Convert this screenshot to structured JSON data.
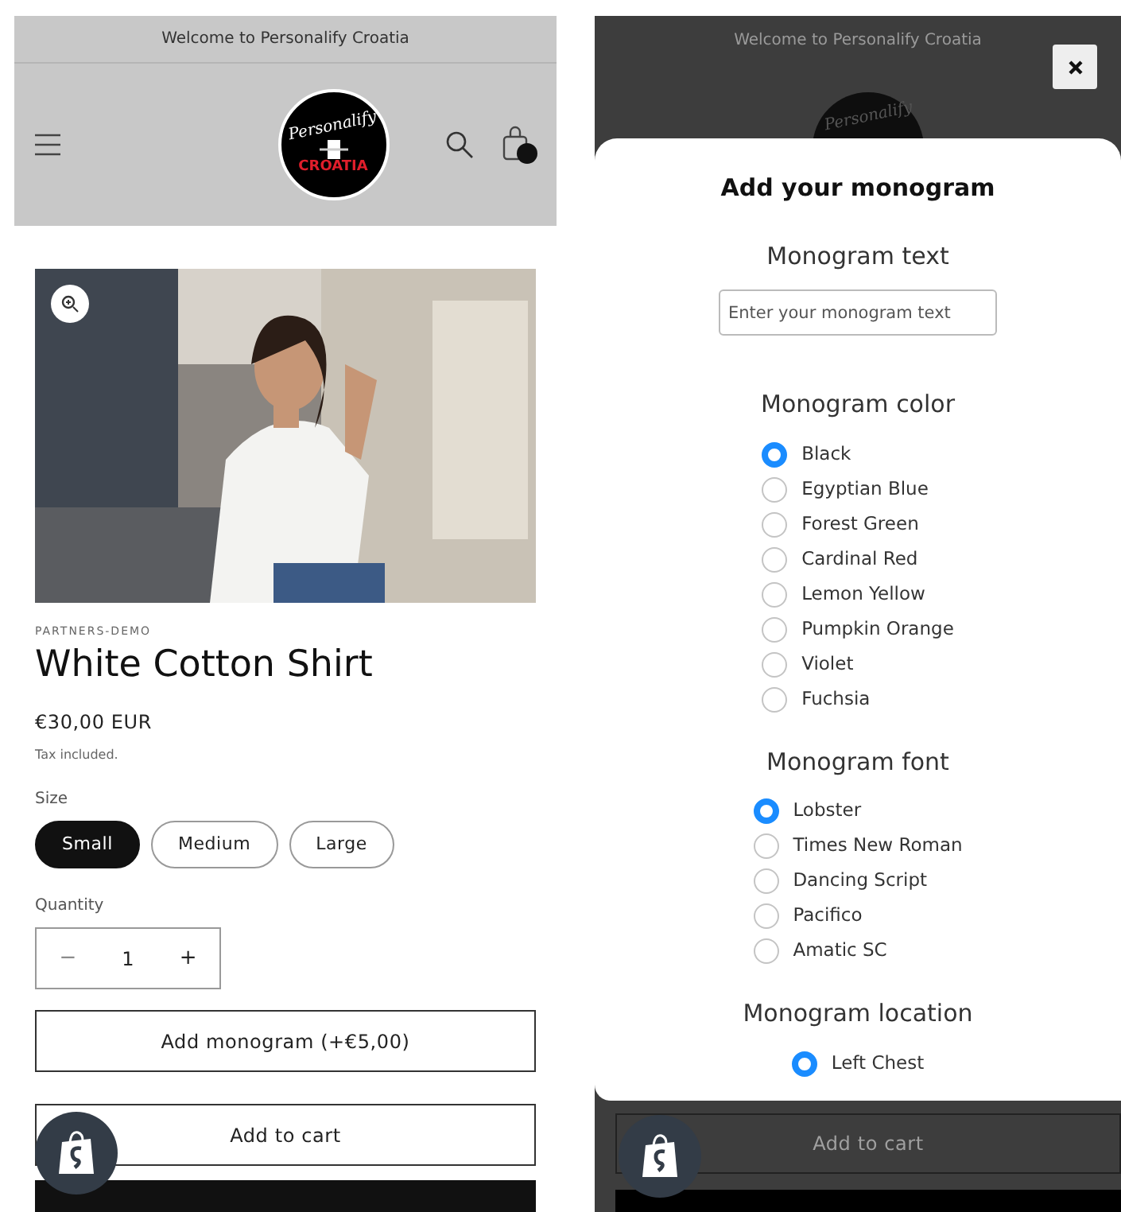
{
  "product_page": {
    "announcement": "Welcome to Personalify Croatia",
    "logo": {
      "top": "Personalify",
      "bottom": "CROATIA"
    },
    "cart_has_items": true,
    "vendor": "PARTNERS-DEMO",
    "title": "White Cotton Shirt",
    "price": "€30,00 EUR",
    "tax_note": "Tax included.",
    "size_label": "Size",
    "sizes": [
      {
        "label": "Small",
        "selected": true
      },
      {
        "label": "Medium",
        "selected": false
      },
      {
        "label": "Large",
        "selected": false
      }
    ],
    "quantity_label": "Quantity",
    "quantity": {
      "minus": "−",
      "value": "1",
      "plus": "+"
    },
    "monogram_button": "Add monogram (+€5,00)",
    "add_to_cart": "Add to cart"
  },
  "modal_view": {
    "background": {
      "announcement": "Welcome to Personalify Croatia",
      "logo_top": "Personalify",
      "add_to_cart": "Add to cart"
    },
    "modal": {
      "title": "Add your monogram",
      "sections": [
        {
          "kind": "text",
          "label": "Monogram text",
          "placeholder": "Enter your monogram text"
        },
        {
          "kind": "radio",
          "label": "Monogram color",
          "options": [
            {
              "label": "Black",
              "selected": true
            },
            {
              "label": "Egyptian Blue",
              "selected": false
            },
            {
              "label": "Forest Green",
              "selected": false
            },
            {
              "label": "Cardinal Red",
              "selected": false
            },
            {
              "label": "Lemon Yellow",
              "selected": false
            },
            {
              "label": "Pumpkin Orange",
              "selected": false
            },
            {
              "label": "Violet",
              "selected": false
            },
            {
              "label": "Fuchsia",
              "selected": false
            }
          ]
        },
        {
          "kind": "radio",
          "label": "Monogram font",
          "options": [
            {
              "label": "Lobster",
              "selected": true
            },
            {
              "label": "Times New Roman",
              "selected": false
            },
            {
              "label": "Dancing Script",
              "selected": false
            },
            {
              "label": "Pacifico",
              "selected": false
            },
            {
              "label": "Amatic SC",
              "selected": false
            }
          ]
        },
        {
          "kind": "radio",
          "label": "Monogram location",
          "options": [
            {
              "label": "Left Chest",
              "selected": true
            }
          ]
        }
      ]
    }
  }
}
